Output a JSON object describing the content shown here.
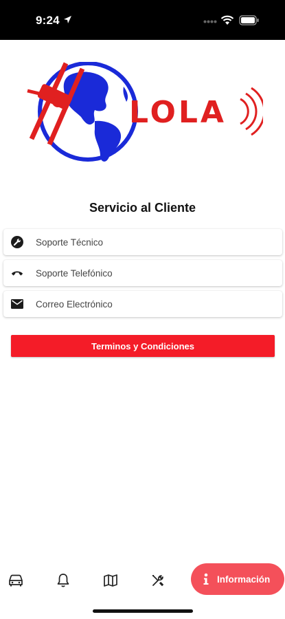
{
  "status_bar": {
    "time": "9:24"
  },
  "logo": {
    "text": "LOLA"
  },
  "support": {
    "title": "Servicio al Cliente",
    "items": [
      {
        "label": "Soporte Técnico",
        "icon": "wrench-icon"
      },
      {
        "label": "Soporte Telefónico",
        "icon": "phone-icon"
      },
      {
        "label": "Correo Electrónico",
        "icon": "mail-icon"
      }
    ]
  },
  "terms_button": {
    "label": "Terminos y Condiciones"
  },
  "bottom_nav": {
    "items": [
      {
        "icon": "car-icon"
      },
      {
        "icon": "bell-icon"
      },
      {
        "icon": "map-icon"
      },
      {
        "icon": "tools-icon"
      },
      {
        "icon": "info-icon",
        "label": "Información",
        "active": true
      }
    ]
  },
  "colors": {
    "accent": "#f41c28",
    "active_pill": "#f4505a",
    "globe_blue": "#1a2ad8"
  }
}
